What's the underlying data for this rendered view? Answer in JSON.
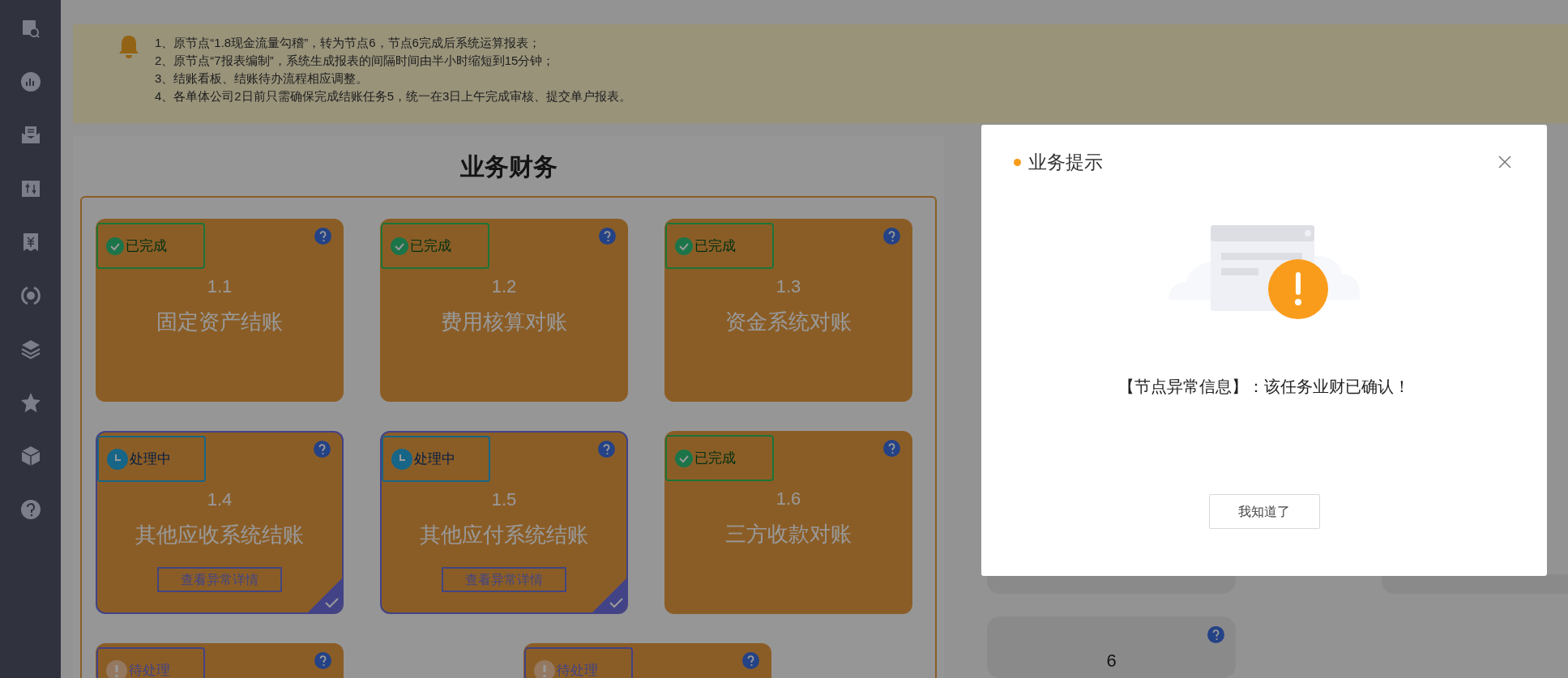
{
  "notice": {
    "lines": [
      "1、原节点“1.8现金流量勾稽”，转为节点6，节点6完成后系统运算报表；",
      "2、原节点“7报表编制”，系统生成报表的间隔时间由半小时缩短到15分钟；",
      "3、结账看板、结账待办流程相应调整。",
      "4、各单体公司2日前只需确保完成结账任务5，统一在3日上午完成审核、提交单户报表。"
    ]
  },
  "section": {
    "title": "业务财务",
    "rows": [
      [
        {
          "kind": "done",
          "status_label": "已完成",
          "number": "1.1",
          "name": "固定资产结账"
        },
        {
          "kind": "done",
          "status_label": "已完成",
          "number": "1.2",
          "name": "费用核算对账"
        },
        {
          "kind": "done",
          "status_label": "已完成",
          "number": "1.3",
          "name": "资金系统对账"
        }
      ],
      [
        {
          "kind": "processing",
          "status_label": "处理中",
          "number": "1.4",
          "name": "其他应收系统结账",
          "action": "查看异常详情"
        },
        {
          "kind": "processing",
          "status_label": "处理中",
          "number": "1.5",
          "name": "其他应付系统结账",
          "action": "查看异常详情"
        },
        {
          "kind": "done",
          "status_label": "已完成",
          "number": "1.6",
          "name": "三方收款对账"
        }
      ],
      [
        {
          "kind": "pending",
          "status_label": "待处理"
        },
        {
          "kind": "pending",
          "status_label": "待处理"
        }
      ]
    ]
  },
  "right_panel": {
    "cards": [
      {
        "number": "6"
      }
    ]
  },
  "dialog": {
    "title": "业务提示",
    "message": "【节点异常信息】：该任务业财已确认！",
    "button": "我知道了"
  }
}
